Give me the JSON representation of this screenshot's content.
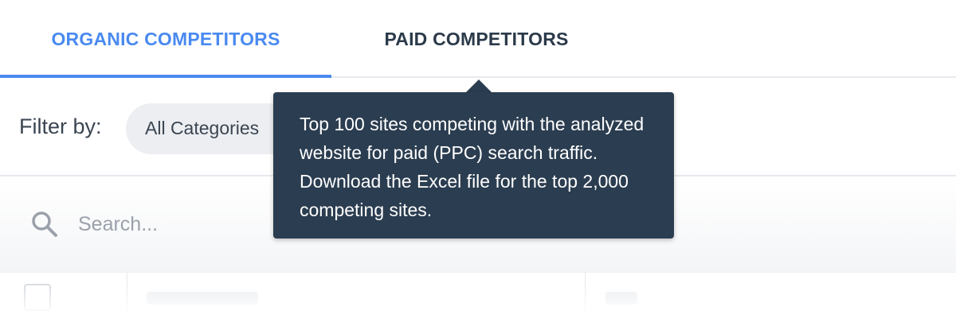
{
  "tabs": {
    "organic_label": "ORGANIC COMPETITORS",
    "paid_label": "PAID COMPETITORS",
    "active": "organic"
  },
  "filter": {
    "label": "Filter by:",
    "selected": "All Categories"
  },
  "search": {
    "placeholder": "Search...",
    "icon": "search-icon"
  },
  "tooltip": {
    "text": "Top 100 sites competing with the analyzed website for paid (PPC) search traffic. Download the Excel file for the top 2,000 competing sites."
  },
  "colors": {
    "accent": "#4a8af0",
    "tab_text": "#2b3a4a",
    "tooltip_bg": "#2b3d50",
    "pill_bg": "#eceef1"
  }
}
